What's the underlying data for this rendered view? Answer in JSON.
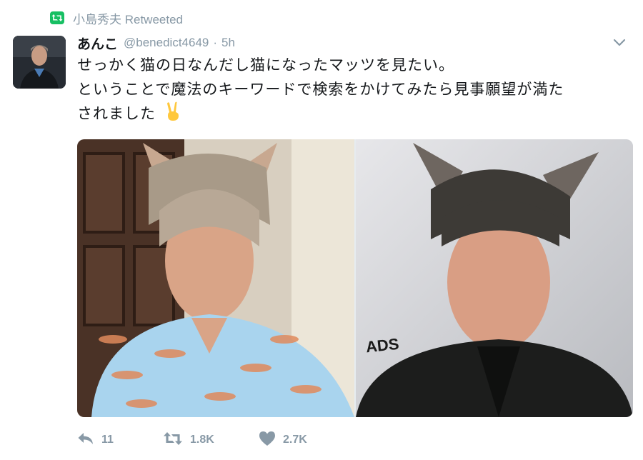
{
  "retweet": {
    "label": "小島秀夫 Retweeted",
    "icon": "retweet-icon",
    "color": "#17bf63"
  },
  "tweet": {
    "display_name": "あんこ",
    "handle": "@benedict4649",
    "separator": "·",
    "time": "5h",
    "text_lines": [
      "せっかく猫の日なんだし猫になったマッツを見たい。",
      "ということで魔法のキーワードで検索をかけてみたら見事願望が満た",
      "されました"
    ],
    "emoji_icon": "victory-hand-icon",
    "photo_right_text": "ADS"
  },
  "actions": {
    "reply_count": "11",
    "retweet_count": "1.8K",
    "like_count": "2.7K"
  },
  "colors": {
    "muted": "#8899a6",
    "text": "#14171a",
    "accent_green": "#17bf63"
  }
}
